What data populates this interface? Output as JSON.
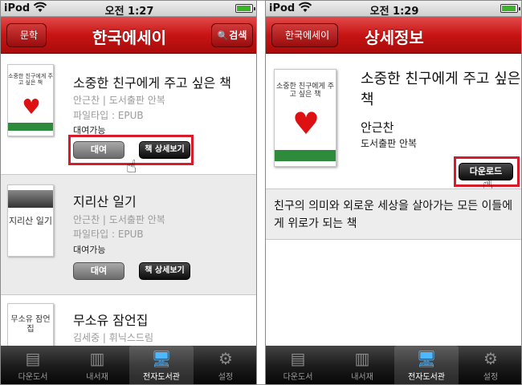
{
  "status_bar": {
    "carrier": "iPod",
    "left_time": "오전 1:27",
    "right_time": "오전 1:29"
  },
  "left_screen": {
    "nav_back_label": "문학",
    "nav_title": "한국에세이",
    "search_label": "검색",
    "books": [
      {
        "title": "소중한 친구에게 주고 싶은 책",
        "meta": "안근찬 | 도서출판 안복",
        "filetype": "파일타입 : EPUB",
        "availability": "대여가능",
        "rent_label": "대여",
        "detail_label": "책 상세보기",
        "cover_text": "소중한 친구에게 주고 싶은 책"
      },
      {
        "title": "지리산 일기",
        "meta": "안근찬 | 도서출판 안복",
        "filetype": "파일타입 : EPUB",
        "availability": "대여가능",
        "rent_label": "대여",
        "detail_label": "책 상세보기",
        "cover_text": "지리산 일기"
      },
      {
        "title": "무소유 잠언집",
        "meta": "김세중 | 휘닉스드림",
        "cover_text": "무소유 잠언집"
      }
    ]
  },
  "right_screen": {
    "nav_back_label": "한국에세이",
    "nav_title": "상세정보",
    "book_title": "소중한 친구에게 주고 싶은 책",
    "author": "안근찬",
    "publisher": "도서출판 안복",
    "download_label": "다운로드",
    "description": "친구의 의미와 외로운 세상을 살아가는 모든 이들에게 위로가 되는 책",
    "cover_text": "소중한 친구에게 주고 싶은 책"
  },
  "tab_bar": {
    "items": [
      {
        "label": "다운도서",
        "icon": "books-download-icon"
      },
      {
        "label": "내서재",
        "icon": "bookshelf-icon"
      },
      {
        "label": "전자도서관",
        "icon": "e-library-monitor-icon",
        "active": true
      },
      {
        "label": "설정",
        "icon": "gear-icon"
      }
    ]
  },
  "colors": {
    "nav_red": "#c81414",
    "highlight_red": "#d81b2a",
    "tab_active_blue": "#4fb7ff"
  }
}
